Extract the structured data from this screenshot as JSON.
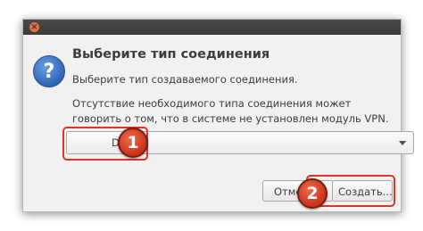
{
  "dialog": {
    "close_glyph": "×",
    "icon_glyph": "?",
    "title": "Выберите тип соединения",
    "subtitle": "Выберите тип создаваемого соединения.",
    "note": "Отсутствие необходимого типа соединения может говорить о том, что в системе не установлен модуль VPN.",
    "connection_type": {
      "selected": "DSL"
    },
    "buttons": {
      "cancel": "Отме",
      "create": "Создать..."
    }
  },
  "annotations": {
    "step1": "1",
    "step2": "2",
    "color": "#d9352b"
  }
}
